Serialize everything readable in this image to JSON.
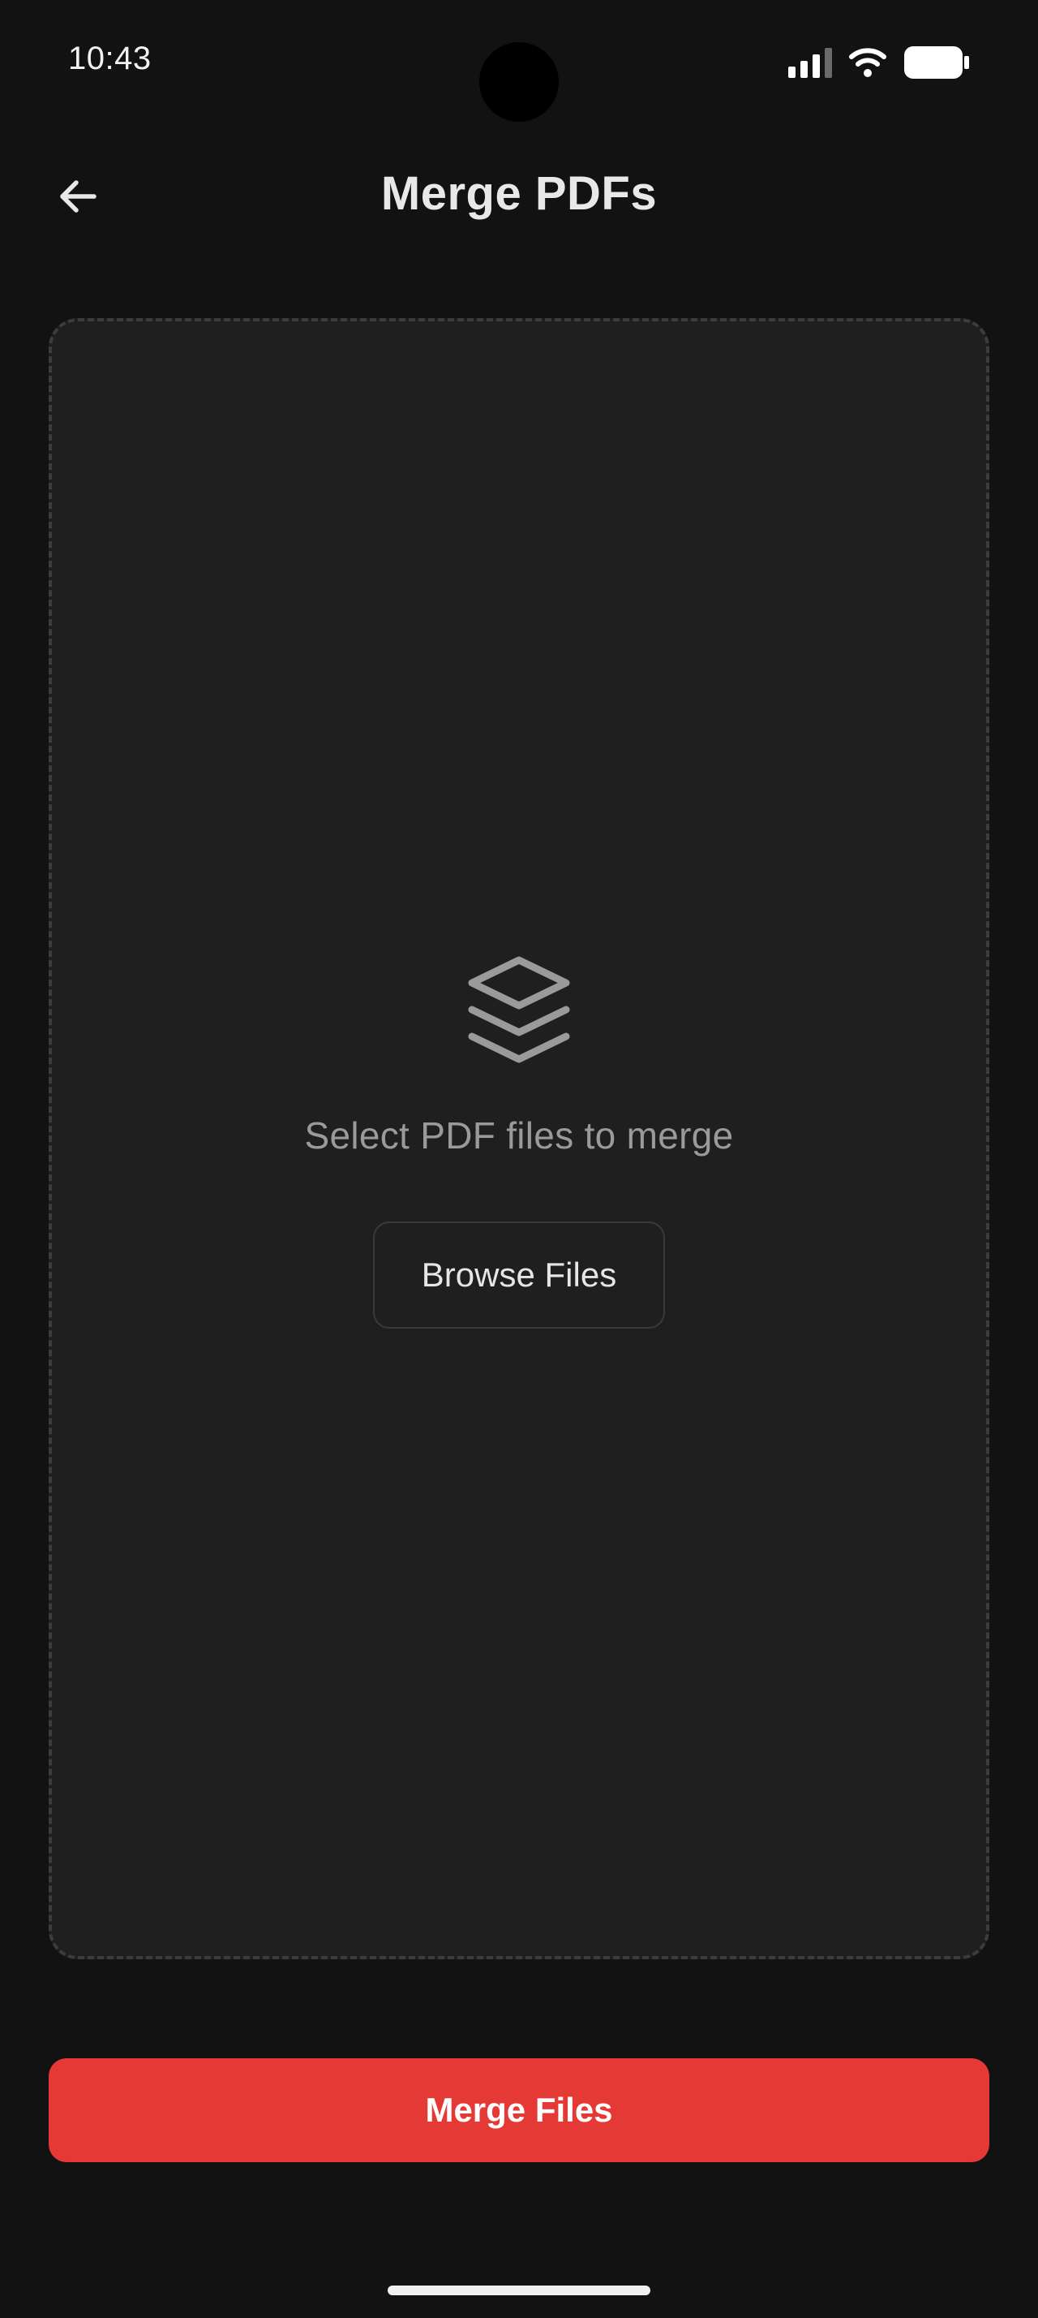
{
  "status_bar": {
    "time": "10:43",
    "icons": [
      "signal-icon",
      "wifi-icon",
      "battery-icon"
    ]
  },
  "header": {
    "back_icon": "arrow-left-icon",
    "title": "Merge PDFs"
  },
  "drop_zone": {
    "icon": "layers-icon",
    "hint": "Select PDF files to merge",
    "browse_label": "Browse Files"
  },
  "actions": {
    "merge_label": "Merge Files"
  },
  "colors": {
    "background": "#121212",
    "surface": "#1f1f1f",
    "accent": "#e53935",
    "text_primary": "#e8e8e8",
    "text_secondary": "#9a9a9a"
  }
}
